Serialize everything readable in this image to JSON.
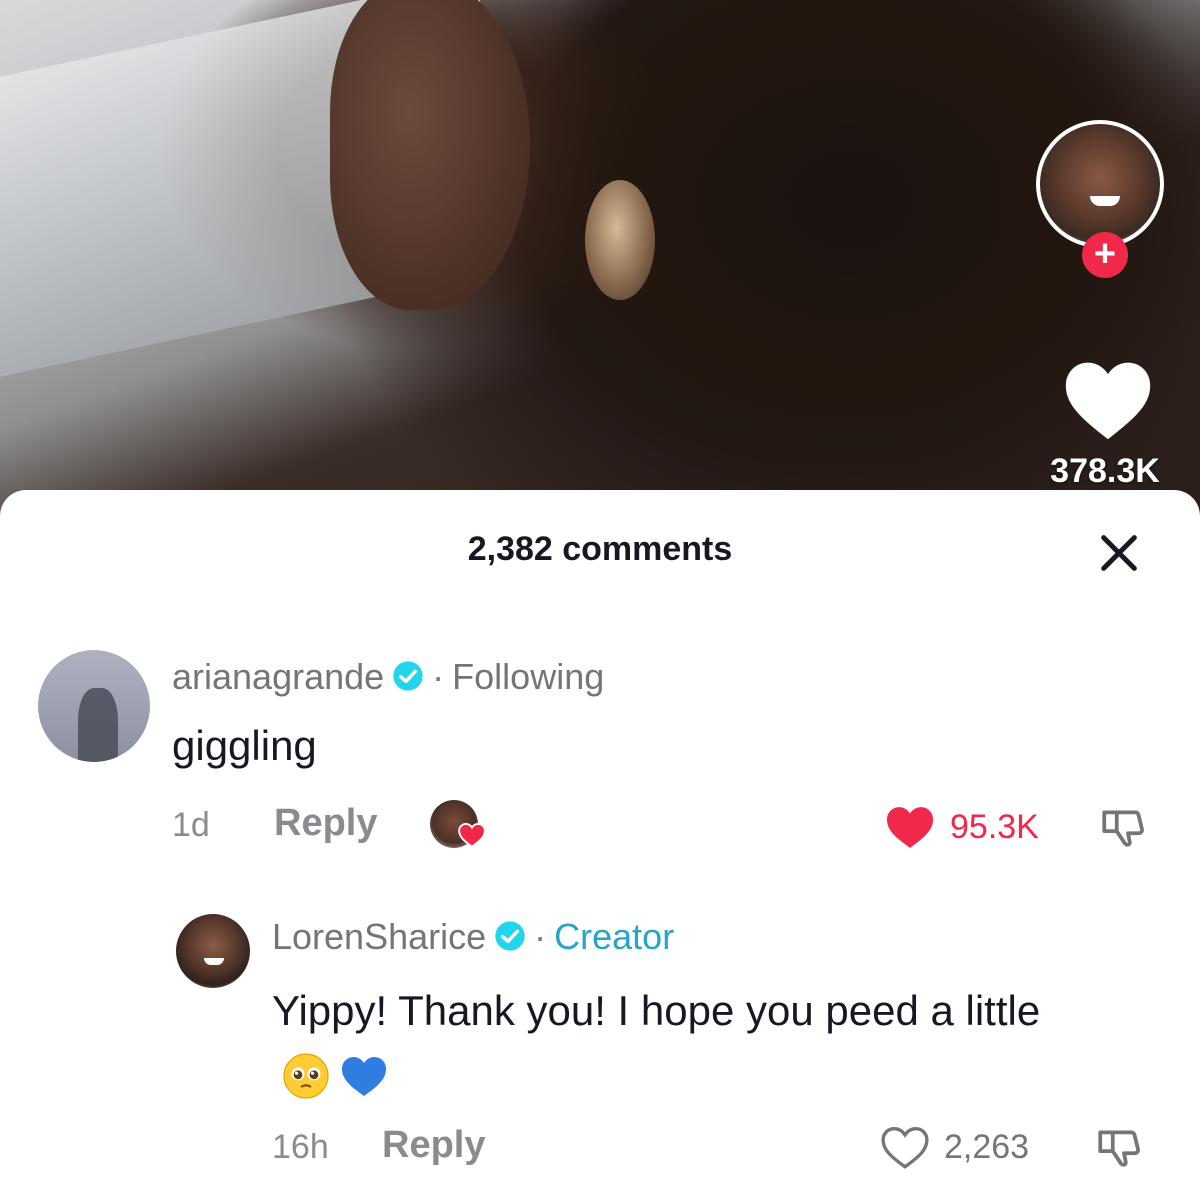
{
  "video": {
    "like_count": "378.3K"
  },
  "comments_sheet": {
    "title": "2,382 comments",
    "comment": {
      "username": "arianagrande",
      "separator": "·",
      "relation": "Following",
      "text": "giggling",
      "age": "1d",
      "reply_label": "Reply",
      "like_count": "95.3K",
      "liked": true
    },
    "reply": {
      "username": "LorenSharice",
      "separator": "·",
      "badge": "Creator",
      "text": "Yippy! Thank you! I hope you peed a little",
      "emojis": [
        "pleading-face-emoji",
        "blue-heart-emoji"
      ],
      "age": "16h",
      "reply_label": "Reply",
      "like_count": "2,263",
      "liked": false
    }
  },
  "colors": {
    "like_red": "#f0284a",
    "creator_blue": "#29a3c6",
    "verified_blue": "#20d5ec",
    "muted_text": "#757575"
  }
}
